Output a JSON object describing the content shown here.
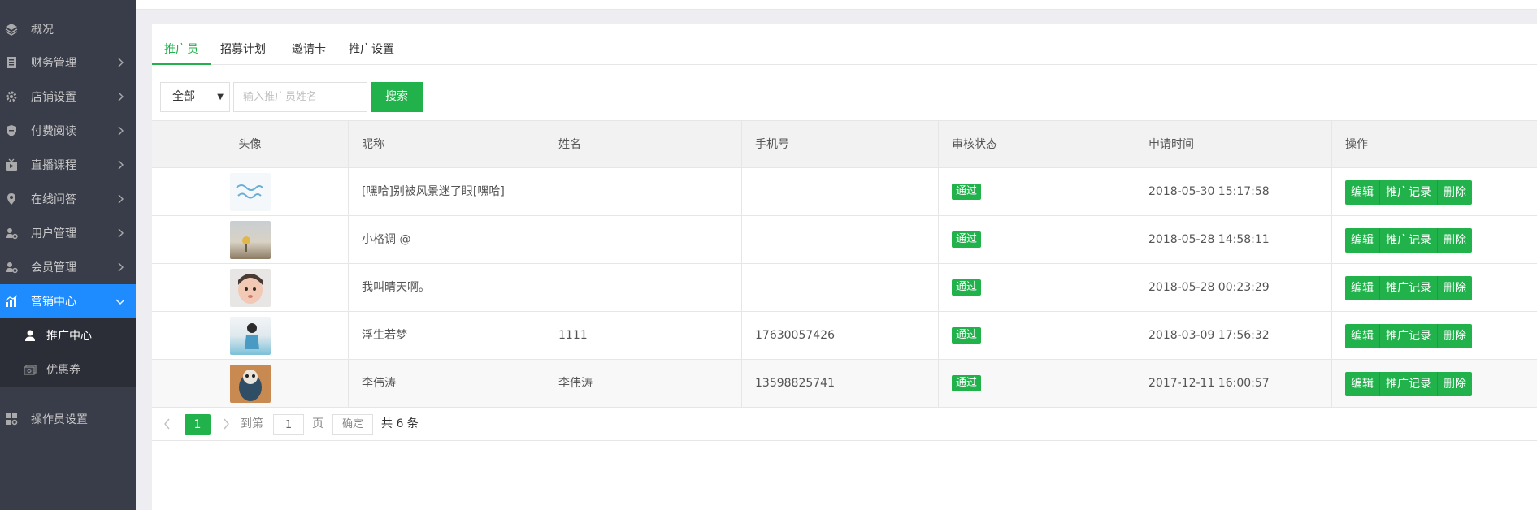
{
  "sidebar": {
    "items": [
      {
        "label": "概况",
        "icon": "layers-icon"
      },
      {
        "label": "财务管理",
        "icon": "ledger-icon"
      },
      {
        "label": "店铺设置",
        "icon": "gear-icon"
      },
      {
        "label": "付费阅读",
        "icon": "shield-icon"
      },
      {
        "label": "直播课程",
        "icon": "tv-icon"
      },
      {
        "label": "在线问答",
        "icon": "location-pin-icon"
      },
      {
        "label": "用户管理",
        "icon": "user-gear-icon"
      },
      {
        "label": "会员管理",
        "icon": "member-gear-icon"
      },
      {
        "label": "营销中心",
        "icon": "bar-chart-icon"
      },
      {
        "label": "操作员设置",
        "icon": "grid-gear-icon"
      }
    ],
    "submenu": [
      {
        "label": "推广中心",
        "icon": "person-icon"
      },
      {
        "label": "优惠券",
        "icon": "coupon-icon"
      }
    ],
    "accent_color": "#1e8cff"
  },
  "tabs": [
    "推广员",
    "招募计划",
    "邀请卡",
    "推广设置"
  ],
  "filter": {
    "selected": "全部",
    "placeholder": "输入推广员姓名",
    "search_label": "搜索"
  },
  "table": {
    "columns": [
      "头像",
      "昵称",
      "姓名",
      "手机号",
      "审核状态",
      "申请时间",
      "操作"
    ],
    "rows": [
      {
        "nickname": "[嘿哈]别被风景迷了眼[嘿哈]",
        "name": "",
        "phone": "",
        "status": "通过",
        "time": "2018-05-30 15:17:58"
      },
      {
        "nickname": "小格调 @",
        "name": "",
        "phone": "",
        "status": "通过",
        "time": "2018-05-28 14:58:11"
      },
      {
        "nickname": "我叫晴天啊。",
        "name": "",
        "phone": "",
        "status": "通过",
        "time": "2018-05-28 00:23:29"
      },
      {
        "nickname": "浮生若梦",
        "name": "1111",
        "phone": "17630057426",
        "status": "通过",
        "time": "2018-03-09 17:56:32"
      },
      {
        "nickname": "李伟涛",
        "name": "李伟涛",
        "phone": "13598825741",
        "status": "通过",
        "time": "2017-12-11 16:00:57"
      }
    ],
    "actions": [
      "编辑",
      "推广记录",
      "删除"
    ]
  },
  "pagination": {
    "current": "1",
    "goto_prefix": "到第",
    "goto_value": "1",
    "goto_suffix": "页",
    "confirm": "确定",
    "total": "共 6 条"
  },
  "colors": {
    "primary_green": "#22b24c",
    "sidebar_bg": "#393d49"
  }
}
